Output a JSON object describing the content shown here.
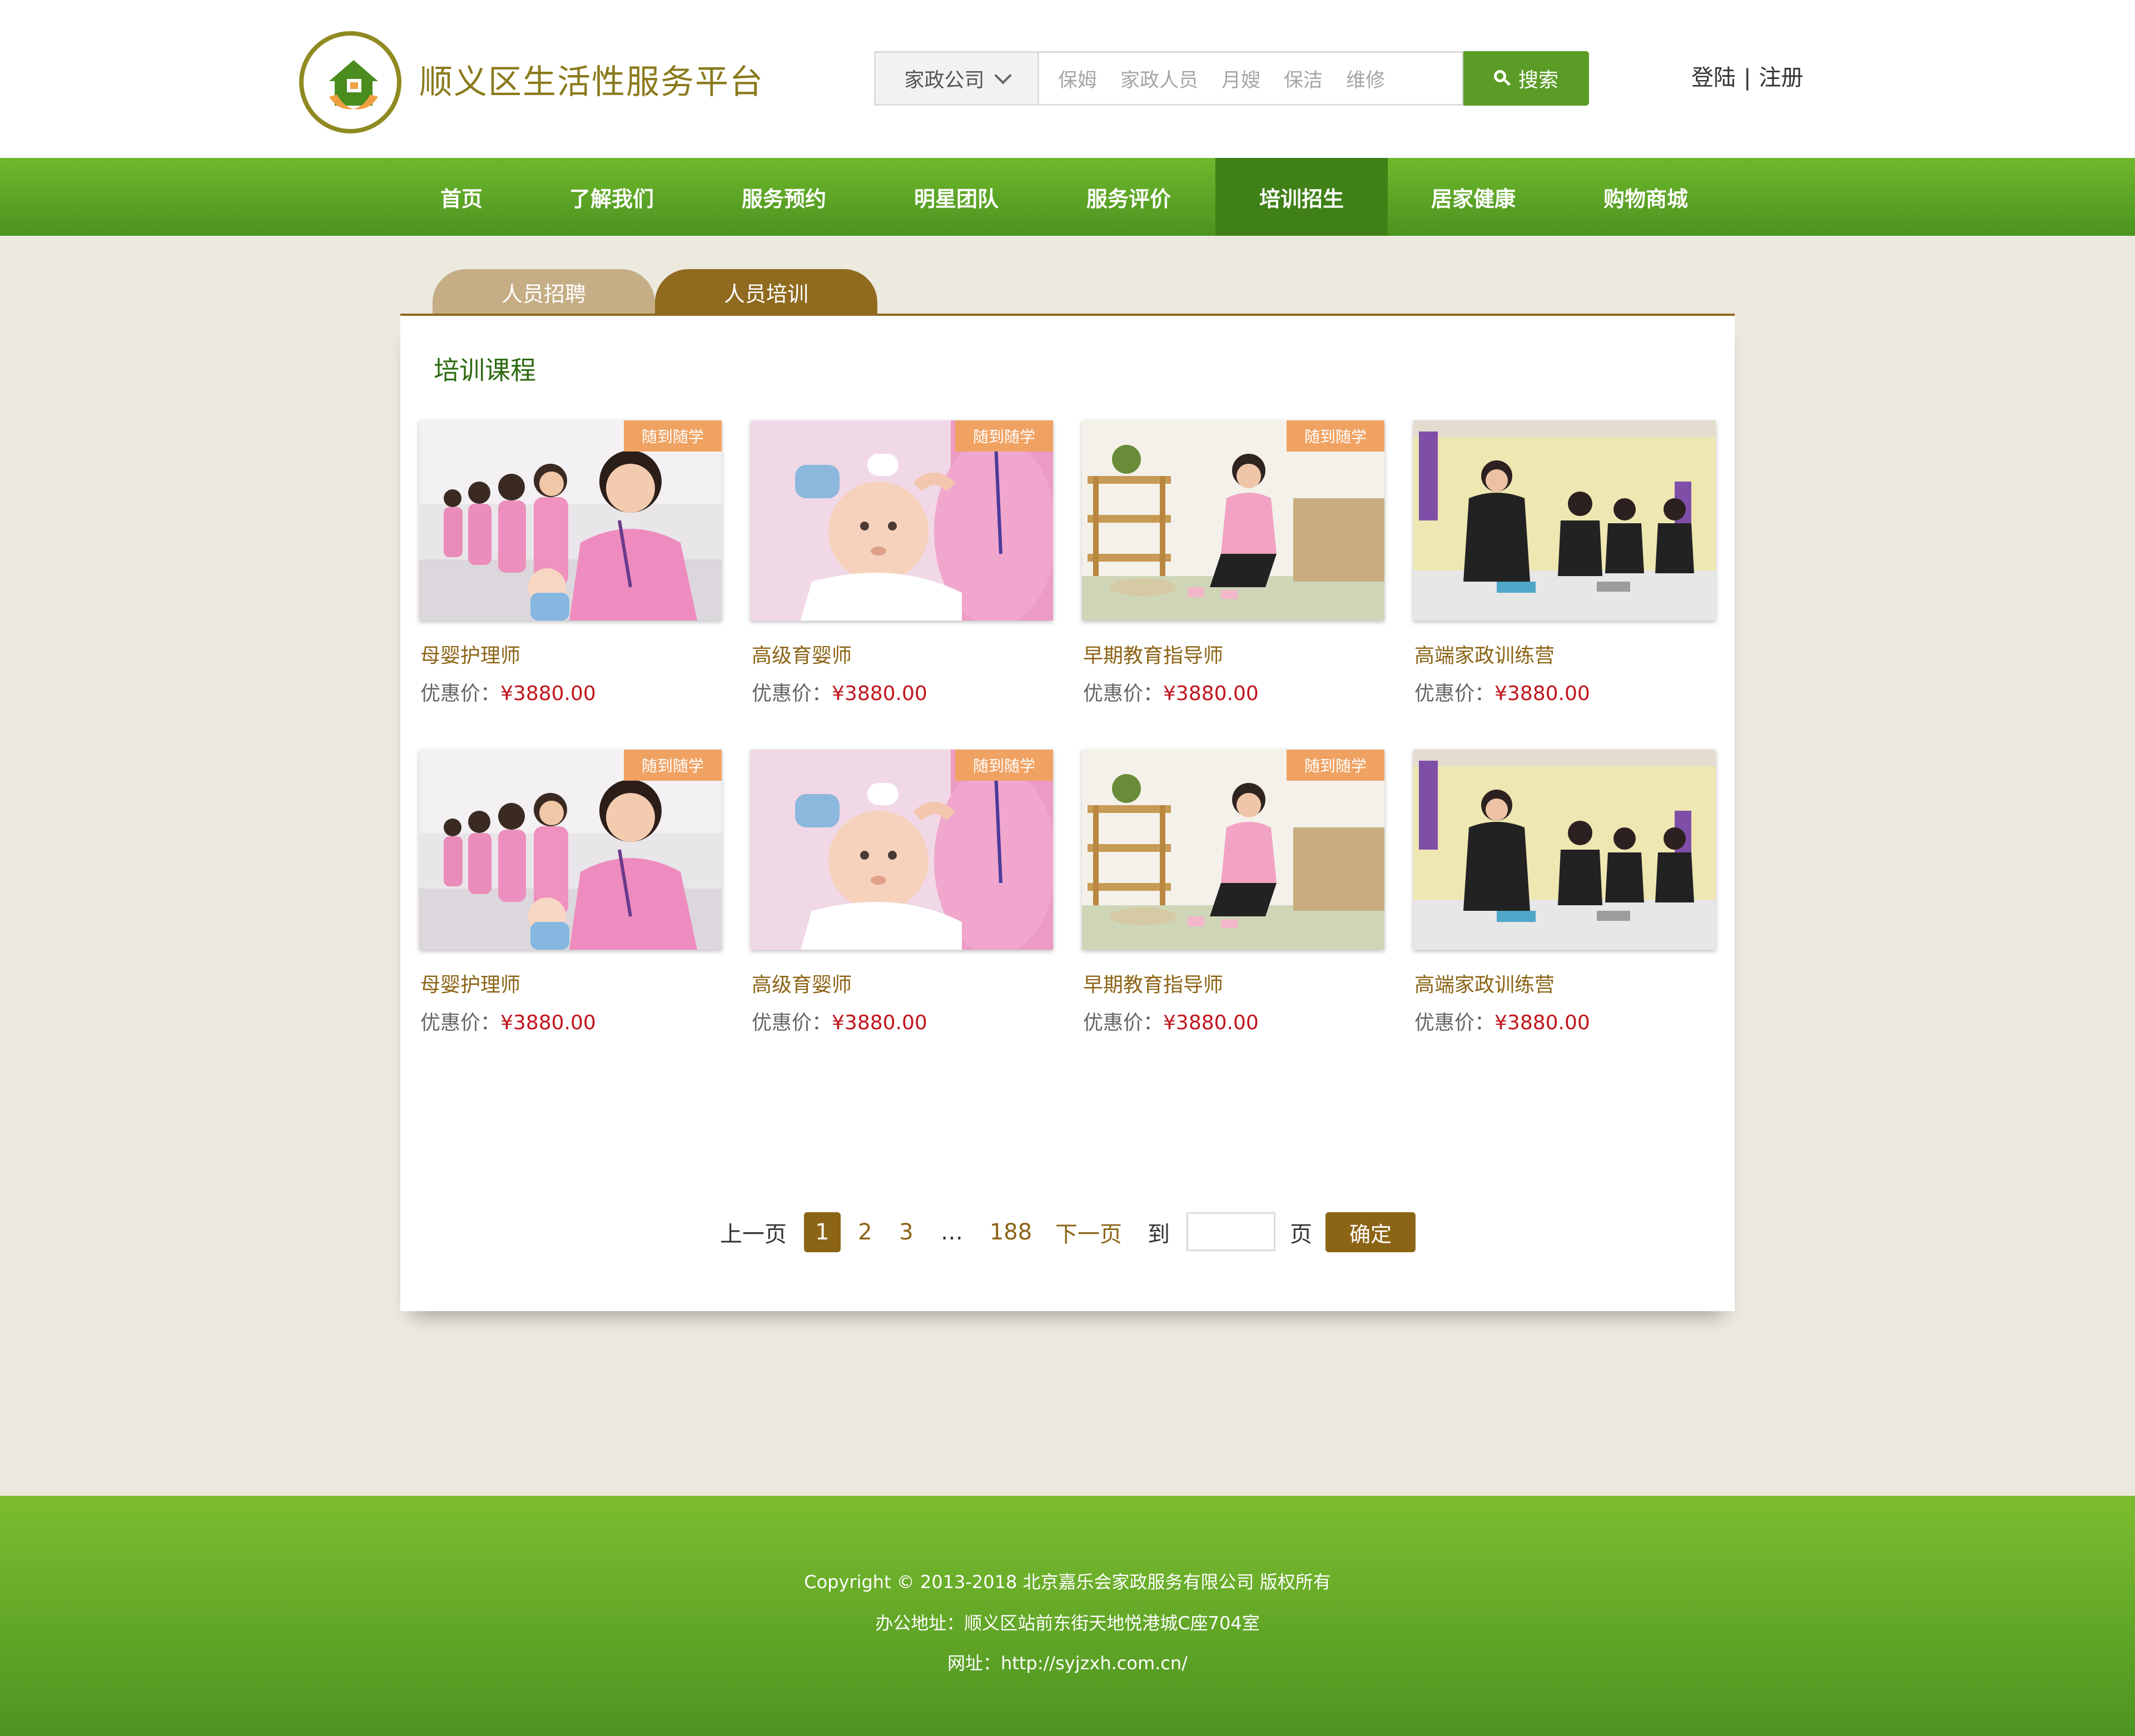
{
  "brand": {
    "title": "顺义区生活性服务平台"
  },
  "search": {
    "category": "家政公司",
    "hints": [
      "保姆",
      "家政人员",
      "月嫂",
      "保洁",
      "维修"
    ],
    "button": "搜索"
  },
  "auth": {
    "login": "登陆",
    "separator": "|",
    "register": "注册"
  },
  "nav": {
    "items": [
      {
        "label": "首页"
      },
      {
        "label": "了解我们"
      },
      {
        "label": "服务预约"
      },
      {
        "label": "明星团队"
      },
      {
        "label": "服务评价"
      },
      {
        "label": "培训招生",
        "active": true
      },
      {
        "label": "居家健康"
      },
      {
        "label": "购物商城"
      }
    ]
  },
  "tabs": {
    "recruit": "人员招聘",
    "training": "人员培训"
  },
  "section": {
    "title": "培训课程"
  },
  "courses": [
    {
      "name": "母婴护理师",
      "badge": "随到随学",
      "price_label": "优惠价：",
      "price": "¥3880.00",
      "photo": "caregivers-pink-uniform-with-baby-dolls"
    },
    {
      "name": "高级育婴师",
      "badge": "随到随学",
      "price_label": "优惠价：",
      "price": "¥3880.00",
      "photo": "feeding-baby-doll"
    },
    {
      "name": "早期教育指导师",
      "badge": "随到随学",
      "price_label": "优惠价：",
      "price": "¥3880.00",
      "photo": "teacher-kneeling-with-blocks"
    },
    {
      "name": "高端家政训练营",
      "badge": "",
      "price_label": "优惠价：",
      "price": "¥3880.00",
      "photo": "staff-in-black-folding-towels"
    },
    {
      "name": "母婴护理师",
      "badge": "随到随学",
      "price_label": "优惠价：",
      "price": "¥3880.00",
      "photo": "caregivers-pink-uniform-with-baby-dolls"
    },
    {
      "name": "高级育婴师",
      "badge": "随到随学",
      "price_label": "优惠价：",
      "price": "¥3880.00",
      "photo": "feeding-baby-doll"
    },
    {
      "name": "早期教育指导师",
      "badge": "随到随学",
      "price_label": "优惠价：",
      "price": "¥3880.00",
      "photo": "teacher-kneeling-with-blocks"
    },
    {
      "name": "高端家政训练营",
      "badge": "",
      "price_label": "优惠价：",
      "price": "¥3880.00",
      "photo": "staff-in-black-folding-towels"
    }
  ],
  "pagination": {
    "prev": "上一页",
    "pages": [
      "1",
      "2",
      "3"
    ],
    "current": "1",
    "ellipsis": "…",
    "last": "188",
    "next": "下一页",
    "goto_label": "到",
    "page_unit": "页",
    "input_value": "",
    "confirm": "确定"
  },
  "footer": {
    "copyright": "Copyright © 2013-2018 北京嘉乐会家政服务有限公司 版权所有",
    "address": "办公地址：顺义区站前东街天地悦港城C座704室",
    "website": "网址：http://syjzxh.com.cn/"
  },
  "colors": {
    "brand_green": "#5a9c26",
    "nav_active": "#3f8017",
    "gold_brown": "#8c6416",
    "tab_light": "#c5ae85",
    "badge_orange": "#f0a262",
    "price_red": "#c0141c",
    "page_bg": "#ece9df"
  }
}
